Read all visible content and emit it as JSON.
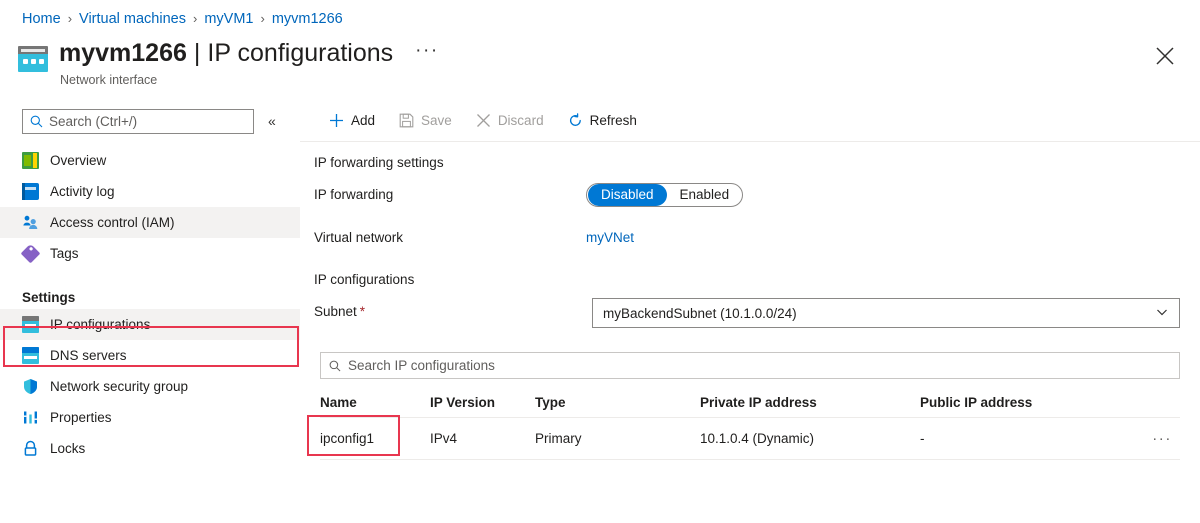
{
  "breadcrumb": {
    "separator": "›",
    "items": [
      {
        "label": "Home"
      },
      {
        "label": "Virtual machines"
      },
      {
        "label": "myVM1"
      },
      {
        "label": "myvm1266"
      }
    ]
  },
  "header": {
    "resource_name": "myvm1266",
    "pipe": "|",
    "page_title": "IP configurations",
    "more_ellipsis": "···",
    "subtitle": "Network interface",
    "close_icon": "close-icon",
    "resource_icon": "network-interface-icon"
  },
  "sidebar": {
    "search": {
      "placeholder": "Search (Ctrl+/)",
      "icon": "search-icon",
      "value": ""
    },
    "collapse_icon": "«",
    "items": [
      {
        "label": "Overview",
        "icon": "overview-icon",
        "selected": false
      },
      {
        "label": "Activity log",
        "icon": "activity-log-icon",
        "selected": false
      },
      {
        "label": "Access control (IAM)",
        "icon": "access-control-icon",
        "selected": true
      },
      {
        "label": "Tags",
        "icon": "tags-icon",
        "selected": false
      }
    ],
    "group_label": "Settings",
    "settings_items": [
      {
        "label": "IP configurations",
        "icon": "ip-configurations-icon",
        "selected": true
      },
      {
        "label": "DNS servers",
        "icon": "dns-servers-icon",
        "selected": false
      },
      {
        "label": "Network security group",
        "icon": "shield-icon",
        "selected": false
      },
      {
        "label": "Properties",
        "icon": "properties-icon",
        "selected": false
      },
      {
        "label": "Locks",
        "icon": "lock-icon",
        "selected": false
      }
    ]
  },
  "toolbar": {
    "add_label": "Add",
    "save_label": "Save",
    "discard_label": "Discard",
    "refresh_label": "Refresh"
  },
  "main": {
    "ip_forwarding_section": "IP forwarding settings",
    "ip_forwarding_label": "IP forwarding",
    "toggle": {
      "disabled_label": "Disabled",
      "enabled_label": "Enabled",
      "selected": "Disabled"
    },
    "virtual_network_label": "Virtual network",
    "virtual_network_value": "myVNet",
    "ip_configurations_section": "IP configurations",
    "subnet_label": "Subnet",
    "subnet_required_marker": "*",
    "subnet_value": "myBackendSubnet (10.1.0.0/24)",
    "subnet_chevron": "chevron-down-icon",
    "filter": {
      "placeholder": "Search IP configurations",
      "icon": "search-icon",
      "value": ""
    },
    "table": {
      "columns": [
        "Name",
        "IP Version",
        "Type",
        "Private IP address",
        "Public IP address"
      ],
      "rows": [
        {
          "name": "ipconfig1",
          "ip_version": "IPv4",
          "type": "Primary",
          "private_ip": "10.1.0.4 (Dynamic)",
          "public_ip": "-",
          "menu": "···"
        }
      ]
    }
  },
  "colors": {
    "accent_blue": "#0078d4",
    "link_blue": "#0066bb",
    "annotation_red": "#e8364f",
    "selected_row_gray": "#f3f2f1",
    "nic_cyan": "#32bedd"
  }
}
